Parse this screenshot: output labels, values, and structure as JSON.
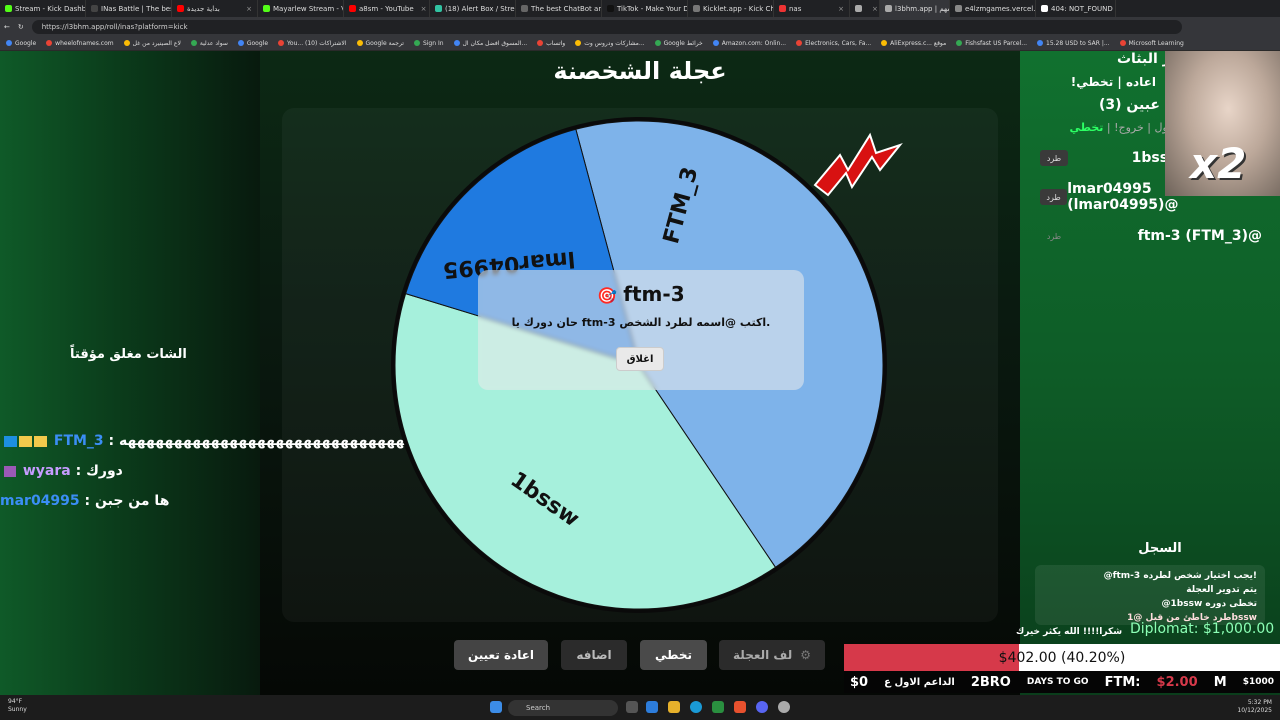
{
  "browser": {
    "tabs": [
      {
        "label": "Stream - Kick Dashb",
        "color": "#53fc18"
      },
      {
        "label": "INas Battle | The best",
        "color": "#444"
      },
      {
        "label": "بداية جديدة",
        "color": "#ff0000"
      },
      {
        "label": "Mayarlew Stream - Vi",
        "color": "#53fc18"
      },
      {
        "label": "a8sm - YouTube",
        "color": "#ff0000"
      },
      {
        "label": "(18) Alert Box / Stream",
        "color": "#31c3a2"
      },
      {
        "label": "The best ChatBot and",
        "color": "#666"
      },
      {
        "label": "TikTok - Make Your D",
        "color": "#111"
      },
      {
        "label": "Kicklet.app - Kick Cha",
        "color": "#777"
      },
      {
        "label": "nas",
        "color": "#e33"
      },
      {
        "label": "",
        "color": "#aaa"
      },
      {
        "label": "l3bhm.app | السهم",
        "color": "#aaa"
      },
      {
        "label": "e4lzmgames.vercel.ap",
        "color": "#888"
      },
      {
        "label": "404: NOT_FOUND",
        "color": "#fff"
      }
    ],
    "url": "https://l3bhm.app/roll/inas?platform=kick",
    "bookmarks": [
      "Google",
      "wheelofnames.com",
      "لاع الصينيرد من غل",
      "سواد عدلية",
      "Google",
      "You... الاشتراكات (10)",
      "Google ترجمة",
      "Sign In",
      "المسوق افضل مكان ال...",
      "واتساب",
      "مشاركات ودروس وت...",
      "Google خرائط",
      "Amazon.com: Onlin...",
      "Electronics, Cars, Fa...",
      "AliExpress.c... موقع",
      "Fishsfast US Parcel...",
      "15.28 USD to SAR |...",
      "Microsoft Learning"
    ]
  },
  "app": {
    "title": "عجلة الشخصنة",
    "wheel": {
      "segments": [
        {
          "name": "FTM_3",
          "color": "#7eb3ea"
        },
        {
          "name": "1bssw",
          "color": "#a6f0dc"
        },
        {
          "name": "lmar04995",
          "color": "#1f7ae0"
        }
      ]
    },
    "modal": {
      "title": "ftm-3",
      "icon": "🎯",
      "message": "حان دورك يا ftm-3 اكتب @اسمه لطرد الشخص.",
      "close_label": "اغلاق"
    },
    "buttons": {
      "reset": "اعادة تعيين",
      "add": "اضافه",
      "skip": "تخطي",
      "spin": "لف العجلة"
    }
  },
  "chat": {
    "closed_notice": "الشات مغلق مؤقتاً",
    "messages": [
      {
        "user": "FTM_3",
        "text": ": ههههههههههههههههههههههههههههههههههههههه"
      },
      {
        "user": "wyara",
        "text": ": دورك"
      },
      {
        "user": "mar04995",
        "text": ": ها من جبن"
      }
    ]
  },
  "right": {
    "header1": "مر البثاث",
    "header2": "!اعاده | تخطي",
    "header3": "عبين (3)",
    "links": [
      "خول",
      "خروج!",
      "تخطي!"
    ],
    "players": [
      {
        "name": "1bssw (1bssw)@",
        "kick": "طرد"
      },
      {
        "name": "lmar04995 (lmar04995)@",
        "kick": "طرد"
      },
      {
        "name": "ftm-3 (FTM_3)@",
        "kick": "طرد"
      }
    ],
    "webcam_overlay": "x2",
    "log_title": "السجل",
    "log": [
      "@ftm-3 يجب اختيار شخص لطرده!",
      "يتم تدوير العجلة",
      "@1bssw تخطى دوره",
      "طرد خاطئ من قبل @1bssw"
    ],
    "diplomat": "Diplomat: $1,000.00"
  },
  "goal": {
    "caption": "شكرا!!!! الله يكثر خيرك",
    "amount_text": "$402.00 (40.20%)",
    "percent": 40.2,
    "ticker_left": "$0",
    "ticker_items": [
      "الداعم الاول ع",
      "2BRO",
      "DAYS TO GO",
      "FTM:",
      "$2.00",
      "M",
      "$1000"
    ]
  },
  "taskbar": {
    "weather_temp": "94°F",
    "weather_desc": "Sunny",
    "search": "Search",
    "time": "5:32 PM",
    "date": "10/12/2025"
  }
}
